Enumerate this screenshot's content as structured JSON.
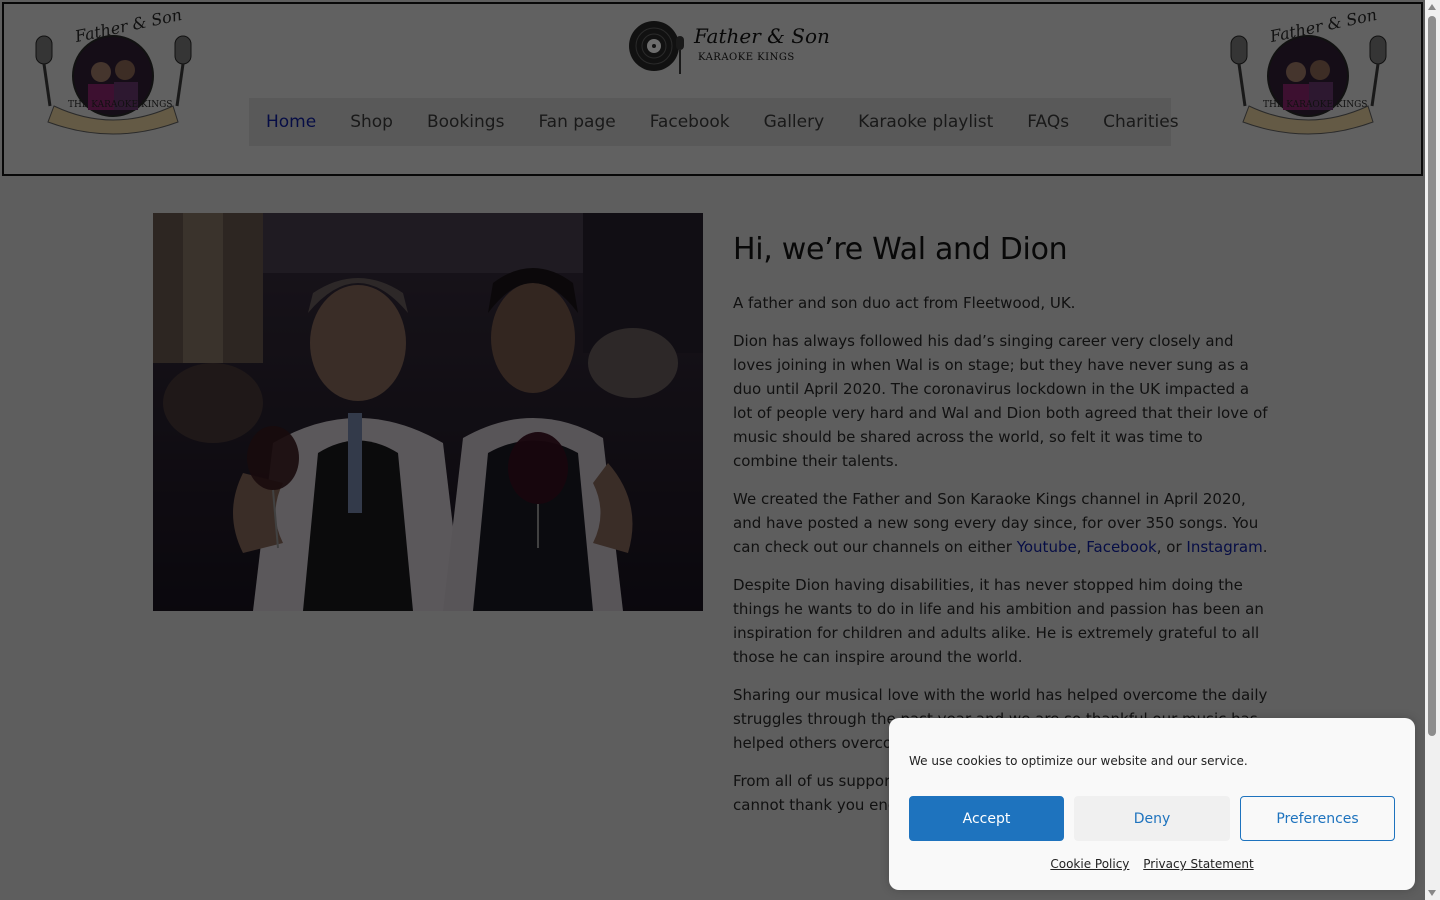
{
  "colors": {
    "accent": "#1e73be",
    "nav_active": "#0d1a8a",
    "link": "#0d1a8a"
  },
  "header": {
    "logo_script": "Father & Son",
    "logo_subtitle": "KARAOKE KINGS",
    "badge_script": "Father & Son",
    "badge_banner": "THE KARAOKE KINGS"
  },
  "nav": {
    "items": [
      {
        "label": "Home",
        "active": true
      },
      {
        "label": "Shop"
      },
      {
        "label": "Bookings"
      },
      {
        "label": "Fan page"
      },
      {
        "label": "Facebook"
      },
      {
        "label": "Gallery"
      },
      {
        "label": "Karaoke playlist"
      },
      {
        "label": "FAQs"
      },
      {
        "label": "Charities"
      }
    ]
  },
  "main": {
    "heading": "Hi, we’re Wal and Dion",
    "p1": "A father and son duo act from Fleetwood, UK.",
    "p2": "Dion has always followed his dad’s singing career very closely and loves joining in when Wal is on stage; but they have never sung as a duo until April 2020. The coronavirus lockdown in the UK impacted a lot of people very hard and Wal and Dion both agreed that their love of music should be shared across the world, so felt it was time to combine their talents.",
    "p3_before": "We created the Father and Son Karaoke Kings channel in April 2020, and have posted a new song every day since, for over 350 songs. You can check out our channels on either ",
    "p3_link_youtube": "Youtube",
    "p3_sep1": ", ",
    "p3_link_facebook": "Facebook",
    "p3_sep2": ", or ",
    "p3_link_instagram": "Instagram",
    "p3_end": ".",
    "p4": "Despite Dion having disabilities, it has never stopped him doing the things he wants to do in life and his ambition and passion has been an inspiration for children and adults alike. He is extremely grateful to all those he can inspire around the world.",
    "p5": "Sharing our musical love with the world has helped overcome the daily struggles through the past year and we are so thankful our music has helped others overcome their own struggles.",
    "p6": "From all of us support"
  },
  "cookie": {
    "message": "We use cookies to optimize our website and our service.",
    "accept": "Accept",
    "deny": "Deny",
    "preferences": "Preferences",
    "cookie_policy": "Cookie Policy",
    "privacy_statement": "Privacy Statement",
    "p6_tail": "cannot thank you enou"
  }
}
